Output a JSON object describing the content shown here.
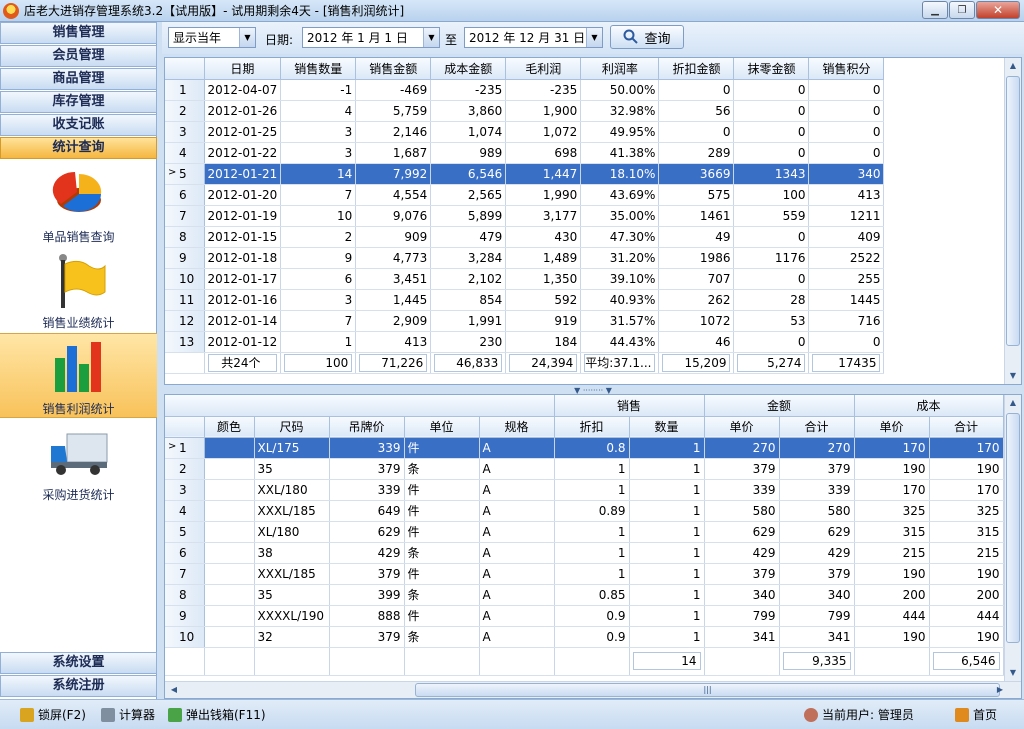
{
  "window": {
    "title": "店老大进销存管理系统3.2【试用版】- 试用期剩余4天 - [销售利润统计]",
    "minimize": "▁",
    "restore": "❐",
    "close": "✕"
  },
  "sidebar": {
    "top_items": [
      {
        "label": "销售管理"
      },
      {
        "label": "会员管理"
      },
      {
        "label": "商品管理"
      },
      {
        "label": "库存管理"
      },
      {
        "label": "收支记账"
      },
      {
        "label": "统计查询"
      }
    ],
    "tools": [
      {
        "label": "单品销售查询",
        "icon": "pie-chart-icon"
      },
      {
        "label": "销售业绩统计",
        "icon": "flag-icon"
      },
      {
        "label": "销售利润统计",
        "icon": "bar-chart-icon"
      },
      {
        "label": "采购进货统计",
        "icon": "truck-icon"
      }
    ],
    "bottom_items": [
      {
        "label": "系统设置"
      },
      {
        "label": "系统注册"
      }
    ]
  },
  "toolbar": {
    "period_value": "显示当年",
    "date_label": "日期:",
    "date_from": "2012 年 1 月 1 日",
    "to_label": "至",
    "date_to": "2012 年 12 月 31 日",
    "query_label": "查询"
  },
  "top_table": {
    "headers": [
      "日期",
      "销售数量",
      "销售金额",
      "成本金额",
      "毛利润",
      "利润率",
      "折扣金额",
      "抹零金额",
      "销售积分"
    ],
    "rows": [
      [
        "1",
        "2012-04-07",
        "-1",
        "-469",
        "-235",
        "-235",
        "50.00%",
        "0",
        "0",
        "0"
      ],
      [
        "2",
        "2012-01-26",
        "4",
        "5,759",
        "3,860",
        "1,900",
        "32.98%",
        "56",
        "0",
        "0"
      ],
      [
        "3",
        "2012-01-25",
        "3",
        "2,146",
        "1,074",
        "1,072",
        "49.95%",
        "0",
        "0",
        "0"
      ],
      [
        "4",
        "2012-01-22",
        "3",
        "1,687",
        "989",
        "698",
        "41.38%",
        "289",
        "0",
        "0"
      ],
      [
        "5",
        "2012-01-21",
        "14",
        "7,992",
        "6,546",
        "1,447",
        "18.10%",
        "3669",
        "1343",
        "340"
      ],
      [
        "6",
        "2012-01-20",
        "7",
        "4,554",
        "2,565",
        "1,990",
        "43.69%",
        "575",
        "100",
        "413"
      ],
      [
        "7",
        "2012-01-19",
        "10",
        "9,076",
        "5,899",
        "3,177",
        "35.00%",
        "1461",
        "559",
        "1211"
      ],
      [
        "8",
        "2012-01-15",
        "2",
        "909",
        "479",
        "430",
        "47.30%",
        "49",
        "0",
        "409"
      ],
      [
        "9",
        "2012-01-18",
        "9",
        "4,773",
        "3,284",
        "1,489",
        "31.20%",
        "1986",
        "1176",
        "2522"
      ],
      [
        "10",
        "2012-01-17",
        "6",
        "3,451",
        "2,102",
        "1,350",
        "39.10%",
        "707",
        "0",
        "255"
      ],
      [
        "11",
        "2012-01-16",
        "3",
        "1,445",
        "854",
        "592",
        "40.93%",
        "262",
        "28",
        "1445"
      ],
      [
        "12",
        "2012-01-14",
        "7",
        "2,909",
        "1,991",
        "919",
        "31.57%",
        "1072",
        "53",
        "716"
      ],
      [
        "13",
        "2012-01-12",
        "1",
        "413",
        "230",
        "184",
        "44.43%",
        "46",
        "0",
        "0"
      ]
    ],
    "selected_row": 5,
    "pointer": ">",
    "summary": [
      "共24个",
      "100",
      "71,226",
      "46,833",
      "24,394",
      "平均:37.1...",
      "15,209",
      "5,274",
      "17435"
    ]
  },
  "bottom_table": {
    "group_headers": [
      "销售",
      "金额",
      "成本"
    ],
    "headers": [
      "颜色",
      "尺码",
      "吊牌价",
      "单位",
      "规格",
      "折扣",
      "数量",
      "单价",
      "合计",
      "单价",
      "合计"
    ],
    "rows": [
      [
        "1",
        "",
        "XL/175",
        "339",
        "件",
        "A",
        "0.8",
        "1",
        "270",
        "270",
        "170",
        "170"
      ],
      [
        "2",
        "",
        "35",
        "379",
        "条",
        "A",
        "1",
        "1",
        "379",
        "379",
        "190",
        "190"
      ],
      [
        "3",
        "",
        "XXL/180",
        "339",
        "件",
        "A",
        "1",
        "1",
        "339",
        "339",
        "170",
        "170"
      ],
      [
        "4",
        "",
        "XXXL/185",
        "649",
        "件",
        "A",
        "0.89",
        "1",
        "580",
        "580",
        "325",
        "325"
      ],
      [
        "5",
        "",
        "XL/180",
        "629",
        "件",
        "A",
        "1",
        "1",
        "629",
        "629",
        "315",
        "315"
      ],
      [
        "6",
        "",
        "38",
        "429",
        "条",
        "A",
        "1",
        "1",
        "429",
        "429",
        "215",
        "215"
      ],
      [
        "7",
        "",
        "XXXL/185",
        "379",
        "件",
        "A",
        "1",
        "1",
        "379",
        "379",
        "190",
        "190"
      ],
      [
        "8",
        "",
        "35",
        "399",
        "条",
        "A",
        "0.85",
        "1",
        "340",
        "340",
        "200",
        "200"
      ],
      [
        "9",
        "",
        "XXXXL/190",
        "888",
        "件",
        "A",
        "0.9",
        "1",
        "799",
        "799",
        "444",
        "444"
      ],
      [
        "10",
        "",
        "32",
        "379",
        "条",
        "A",
        "0.9",
        "1",
        "341",
        "341",
        "190",
        "190"
      ]
    ],
    "selected_row": 1,
    "pointer": ">",
    "summary": {
      "qty": "14",
      "amount_total": "9,335",
      "cost_total": "6,546"
    }
  },
  "status": {
    "lock": "锁屏(F2)",
    "calculator": "计算器",
    "cashbox": "弹出钱箱(F11)",
    "current_user": "当前用户: 管理员",
    "home": "首页"
  },
  "colors": {
    "selection": "#3a6fc6",
    "active_nav": "#f5b640",
    "header_bg": "#dbe8f7"
  }
}
